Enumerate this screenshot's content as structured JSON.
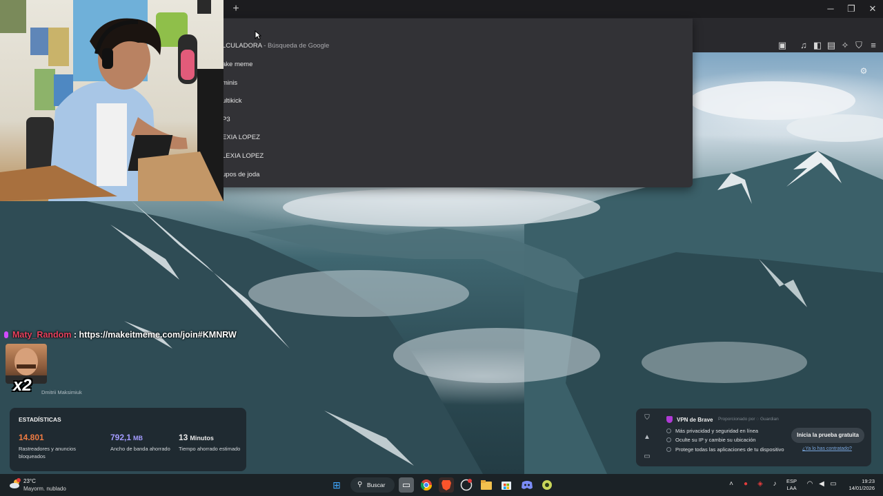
{
  "browser": {
    "new_tab_symbol": "+",
    "window_controls": {
      "minimize": "─",
      "restore": "❐",
      "close": "✕"
    },
    "toolbar_icons": [
      "screenshot-icon",
      "music-icon",
      "sidebar-icon",
      "wallet-icon",
      "leo-ai-icon",
      "vpn-shield-icon",
      "menu-icon"
    ]
  },
  "omnibox": {
    "suggestions": [
      {
        "text": "LCULADORA",
        "sub": "- Búsqueda de Google"
      },
      {
        "text": "ake meme",
        "sub": ""
      },
      {
        "text": "minis",
        "sub": ""
      },
      {
        "text": "ultikick",
        "sub": ""
      },
      {
        "text": "P3",
        "sub": ""
      },
      {
        "text": "EXIA LOPEZ",
        "sub": ""
      },
      {
        "text": "LEXIA LOPEZ",
        "sub": ""
      },
      {
        "text": "upos de joda",
        "sub": ""
      }
    ]
  },
  "overlay": {
    "chat": {
      "username": "Maty_Random",
      "separator": " : ",
      "message": "https://makeitmeme.com/join#KMNRW"
    },
    "meme_multiplier": "x2",
    "photo_credit": "Dmitrii Maksimiuk"
  },
  "stats": {
    "title": "ESTADÍSTICAS",
    "items": [
      {
        "value": "14.801",
        "unit": "",
        "label": "Rastreadores y anuncios bloqueados",
        "color": "#f07c43"
      },
      {
        "value": "792,1",
        "unit": "MB",
        "label": "Ancho de banda ahorrado",
        "color": "#a49cff"
      },
      {
        "value": "13",
        "unit": "Minutos",
        "label": "Tiempo ahorrado estimado",
        "color": "#ffffff"
      }
    ]
  },
  "vpn": {
    "title": "VPN de Brave",
    "powered_by": "Proporcionado por ◌ Guardian",
    "features": [
      "Más privacidad y seguridad en línea",
      "Oculte su IP y cambie su ubicación",
      "Protege todas las aplicaciones de tu dispositivo"
    ],
    "trial_button": "Inicia la prueba gratuita",
    "already_link": "¿Ya lo has contratado?"
  },
  "taskbar": {
    "weather_temp": "23°C",
    "weather_desc": "Mayorm. nublado",
    "search_label": "Buscar",
    "language_top": "ESP",
    "language_bottom": "LAA",
    "time": "19:23",
    "date": "14/01/2026"
  }
}
